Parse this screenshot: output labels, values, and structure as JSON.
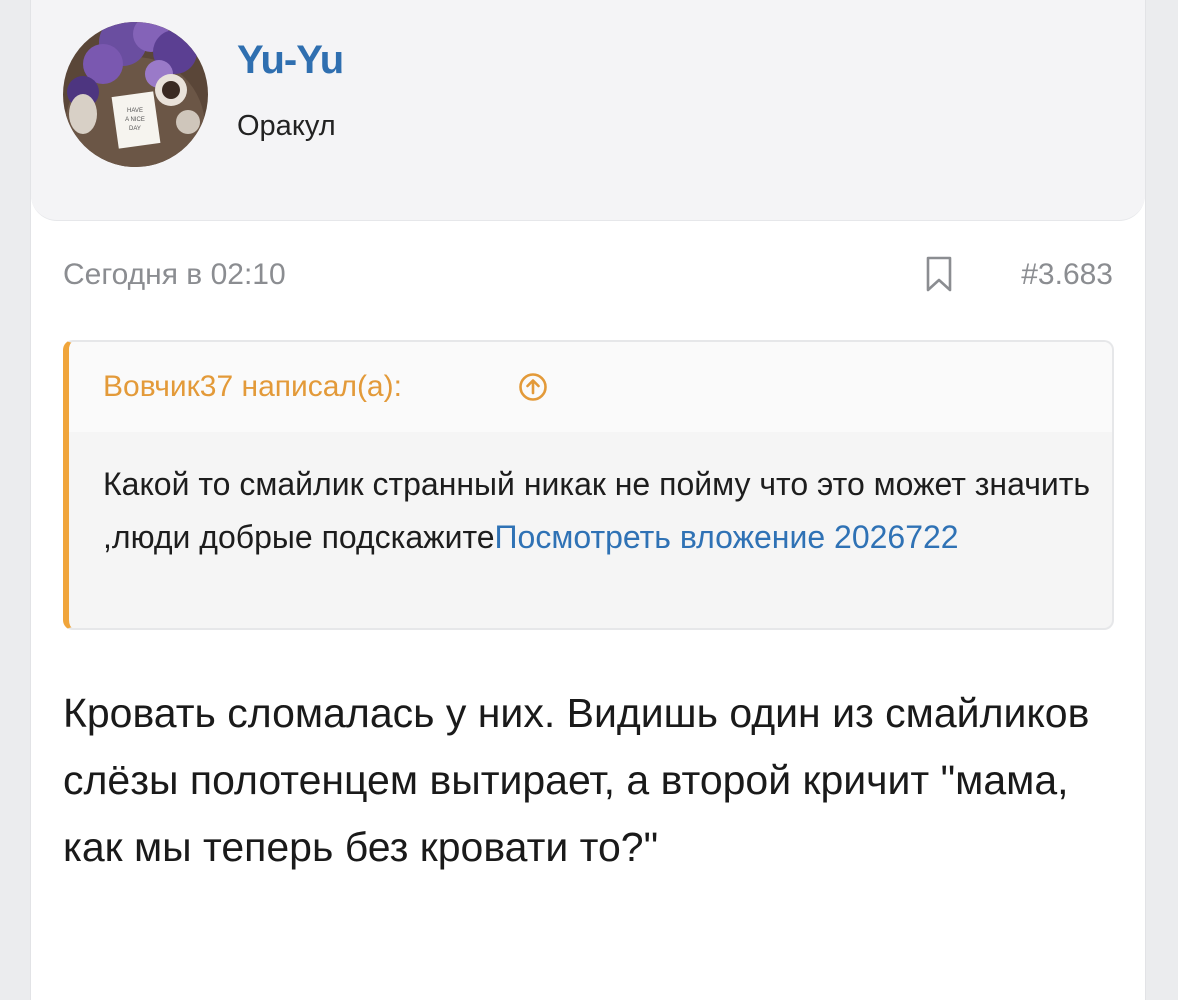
{
  "user": {
    "name": "Yu-Yu",
    "title": "Оракул",
    "avatar_text": [
      "HAVE",
      "A NICE",
      "DAY"
    ]
  },
  "post": {
    "date": "Сегодня в 02:10",
    "number": "#3.683",
    "bookmark_icon": "bookmark-icon",
    "body": "Кровать сломалась у них. Видишь один из смайликов слёзы полотенцем вытирает, а второй кричит \"мама, как мы теперь без кровати то?\""
  },
  "quote": {
    "author": "Вовчик37 написал(а):",
    "text": "Какой то смайлик странный никак не пойму что это может значить ,люди добрые подскажите",
    "attachment_link": "Посмотреть вложение 2026722",
    "jump_icon": "arrow-up-circle-icon"
  },
  "colors": {
    "username": "#2f6fb0",
    "quote_accent": "#f0a53b",
    "quote_author": "#e39a39",
    "link": "#2f72b5",
    "muted": "#8b8d91"
  }
}
